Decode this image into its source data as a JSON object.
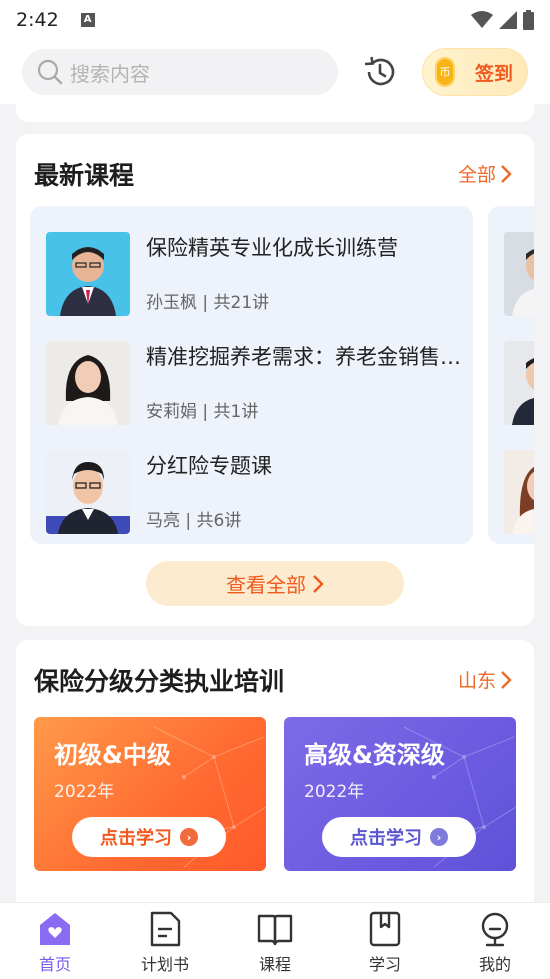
{
  "status_bar": {
    "time": "2:42",
    "badge": "A"
  },
  "search": {
    "placeholder": "搜索内容"
  },
  "checkin": {
    "coin": "币",
    "label": "签到"
  },
  "latest_courses": {
    "title": "最新课程",
    "more_label": "全部",
    "items": [
      {
        "title": "保险精英专业化成长训练营",
        "meta": "孙玉枫 | 共21讲"
      },
      {
        "title": "精准挖掘养老需求：养老金销售实战",
        "meta": "安莉娟 | 共1讲"
      },
      {
        "title": "分红险专题课",
        "meta": "马亮 | 共6讲"
      }
    ],
    "view_all_label": "查看全部"
  },
  "training": {
    "title": "保险分级分类执业培训",
    "region": "山东",
    "cards": [
      {
        "title": "初级&中级",
        "year": "2022年",
        "button": "点击学习"
      },
      {
        "title": "高级&资深级",
        "year": "2022年",
        "button": "点击学习"
      }
    ]
  },
  "bottom_nav": [
    {
      "label": "首页",
      "icon": "home-icon",
      "active": true
    },
    {
      "label": "计划书",
      "icon": "document-icon",
      "active": false
    },
    {
      "label": "课程",
      "icon": "book-icon",
      "active": false
    },
    {
      "label": "学习",
      "icon": "bookmark-icon",
      "active": false
    },
    {
      "label": "我的",
      "icon": "profile-icon",
      "active": false
    }
  ],
  "colors": {
    "accent": "#f05a1e",
    "nav_active": "#7a5cf0",
    "panel": "#edf2fb"
  }
}
